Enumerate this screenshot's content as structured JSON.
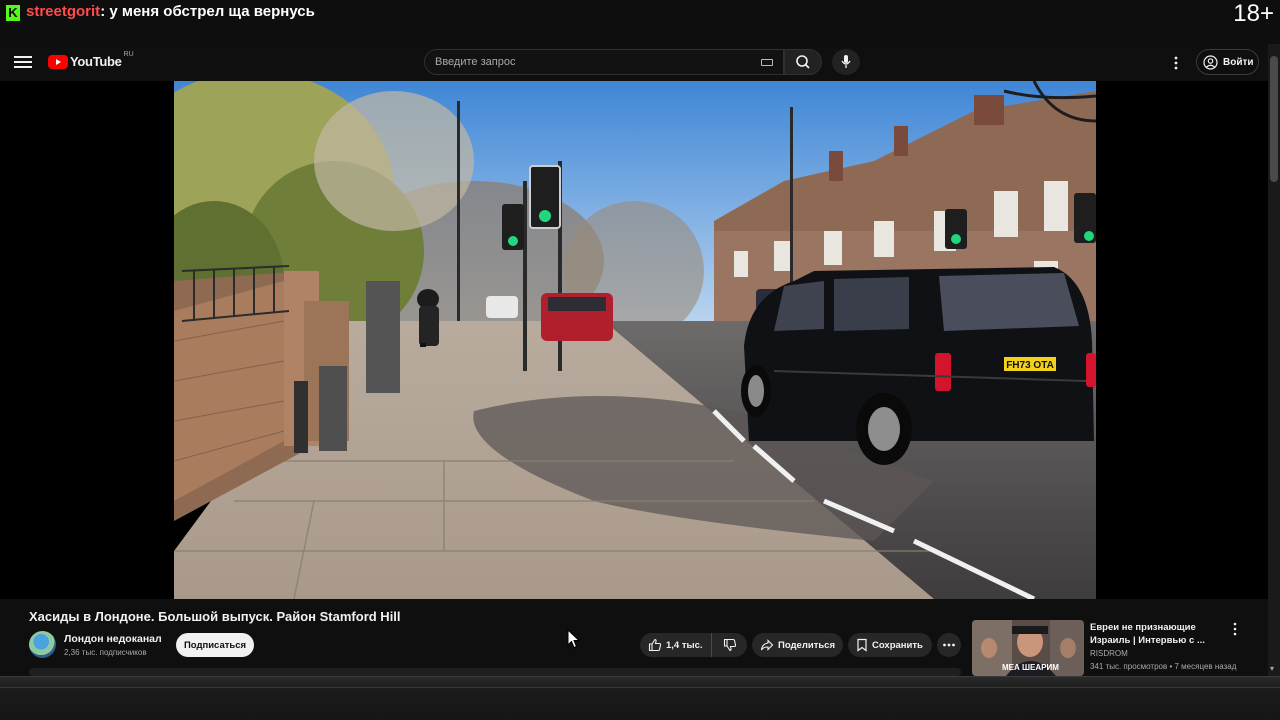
{
  "stream_overlay": {
    "platform_logo": "K",
    "chat_user": "streetgorit",
    "chat_message": ": у меня обстрел ща вернусь",
    "age_rating": "18+"
  },
  "header": {
    "logo_text": "YouTube",
    "logo_region": "RU",
    "search_placeholder": "Введите запрос",
    "signin_label": "Войти",
    "icons": [
      "menu-icon",
      "keyboard-icon",
      "search-icon",
      "mic-icon",
      "more-vert-icon",
      "account-icon"
    ]
  },
  "video": {
    "title": "Хасиды в Лондоне. Большой выпуск. Район Stamford Hill",
    "plate_text": "FH73 OTA",
    "channel_name": "Лондон недоканал",
    "subscribers": "2,36 тыс. подписчиков",
    "subscribe_label": "Подписаться",
    "like_count": "1,4 тыс.",
    "share_label": "Поделиться",
    "save_label": "Сохранить"
  },
  "recommendation": {
    "title": "Евреи не признающие Израиль | Интервью с ...",
    "channel": "RISDROM",
    "meta": "341 тыс. просмотров • 7 месяцев назад",
    "thumb_caption": "МЕА ШЕАРИМ"
  },
  "colors": {
    "kick_green": "#53fc18",
    "chat_user": "#ff4d4d",
    "youtube_red": "#ff0000",
    "background": "#0f0f0f"
  }
}
